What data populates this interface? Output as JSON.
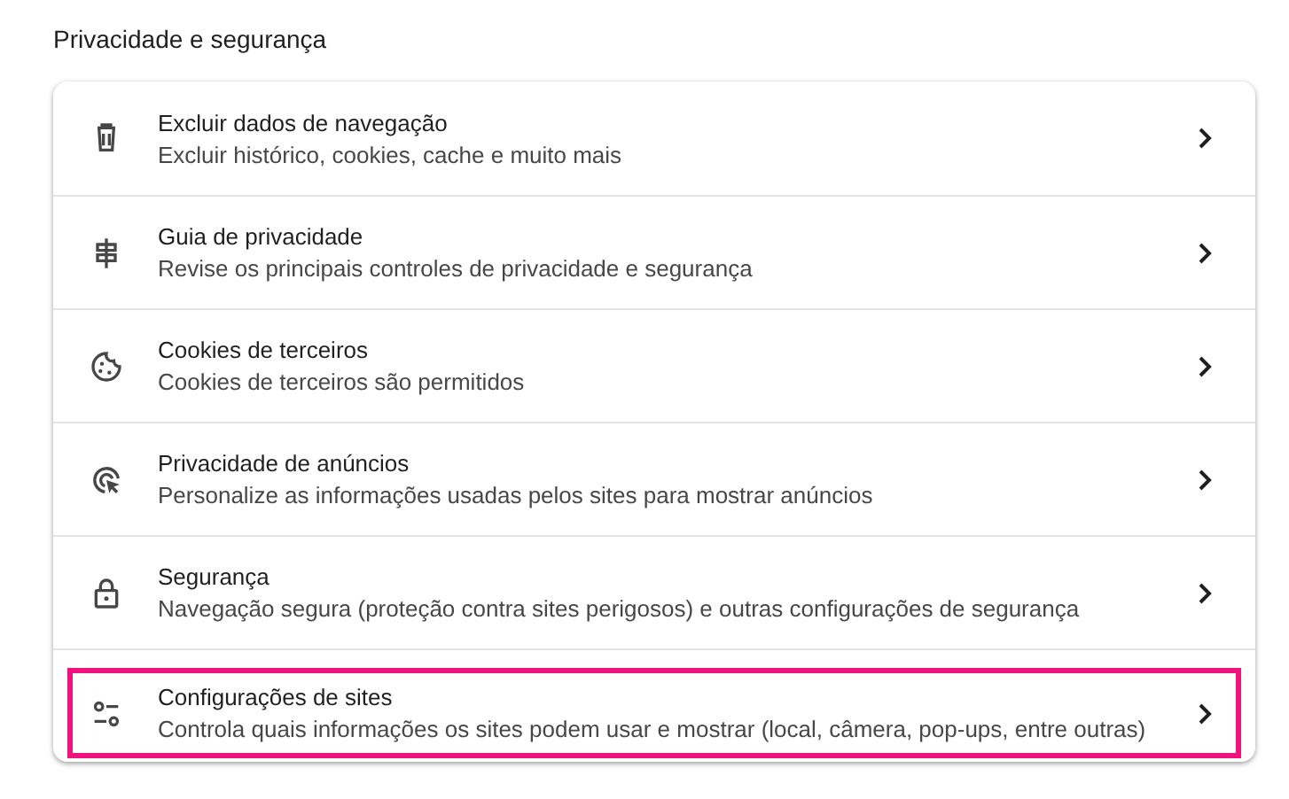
{
  "section_title": "Privacidade e segurança",
  "items": [
    {
      "kind": "trash",
      "title": "Excluir dados de navegação",
      "subtitle": "Excluir histórico, cookies, cache e muito mais",
      "highlighted": false
    },
    {
      "kind": "signpost",
      "title": "Guia de privacidade",
      "subtitle": "Revise os principais controles de privacidade e segurança",
      "highlighted": false
    },
    {
      "kind": "cookie",
      "title": "Cookies de terceiros",
      "subtitle": "Cookies de terceiros são permitidos",
      "highlighted": false
    },
    {
      "kind": "target",
      "title": "Privacidade de anúncios",
      "subtitle": "Personalize as informações usadas pelos sites para mostrar anúncios",
      "highlighted": false
    },
    {
      "kind": "lock",
      "title": "Segurança",
      "subtitle": "Navegação segura (proteção contra sites perigosos) e outras configurações de segurança",
      "highlighted": false
    },
    {
      "kind": "sliders",
      "title": "Configurações de sites",
      "subtitle": "Controla quais informações os sites podem usar e mostrar (local, câmera, pop-ups, entre outras)",
      "highlighted": true
    }
  ]
}
